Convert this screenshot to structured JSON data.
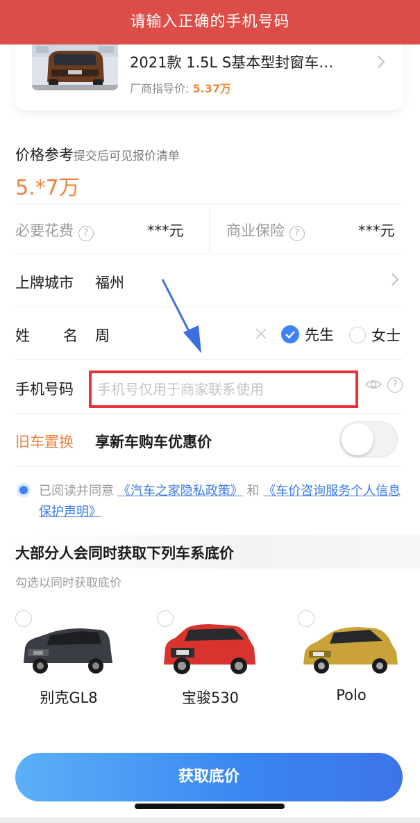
{
  "toast": {
    "message": "请输入正确的手机号码",
    "color": "#dc4d47"
  },
  "top_card": {
    "model_name": "2021款 1.5L S基本型封窗车…",
    "guide_label": "厂商指导价: ",
    "guide_price": "5.37万"
  },
  "price_reference": {
    "label": "价格参考",
    "hint": "提交后可见报价清单",
    "value": "5.*7万"
  },
  "fees": {
    "necessary_label": "必要花费",
    "necessary_value": "***元",
    "insurance_label": "商业保险",
    "insurance_value": "***元"
  },
  "city": {
    "label": "上牌城市",
    "value": "福州"
  },
  "name": {
    "label_1": "姓",
    "label_2": "名",
    "value": "周",
    "option_male": "先生",
    "option_female": "女士",
    "selected": "先生"
  },
  "phone": {
    "label": "手机号码",
    "placeholder": "手机号仅用于商家联系使用"
  },
  "trade_in": {
    "label": "旧车置换",
    "desc": "享新车购车优惠价",
    "enabled": false
  },
  "agreement": {
    "prefix": "已阅读并同意 ",
    "link1": "《汽车之家隐私政策》",
    "and": " 和 ",
    "link2": "《车价咨询服务个人信息保护声明》",
    "checked": true
  },
  "recommend": {
    "title": "大部分人会同时获取下列车系底价",
    "subtitle": "勾选以同时获取底价",
    "cars": [
      {
        "name": "别克GL8",
        "color": "#3b3d44"
      },
      {
        "name": "宝骏530",
        "color": "#d8332f"
      },
      {
        "name": "Polo",
        "color": "#c9a23a"
      }
    ]
  },
  "cta": {
    "label": "获取底价"
  },
  "colors": {
    "accent": "#3e82f7",
    "price": "#f0823a",
    "error_border": "#e8323a"
  }
}
